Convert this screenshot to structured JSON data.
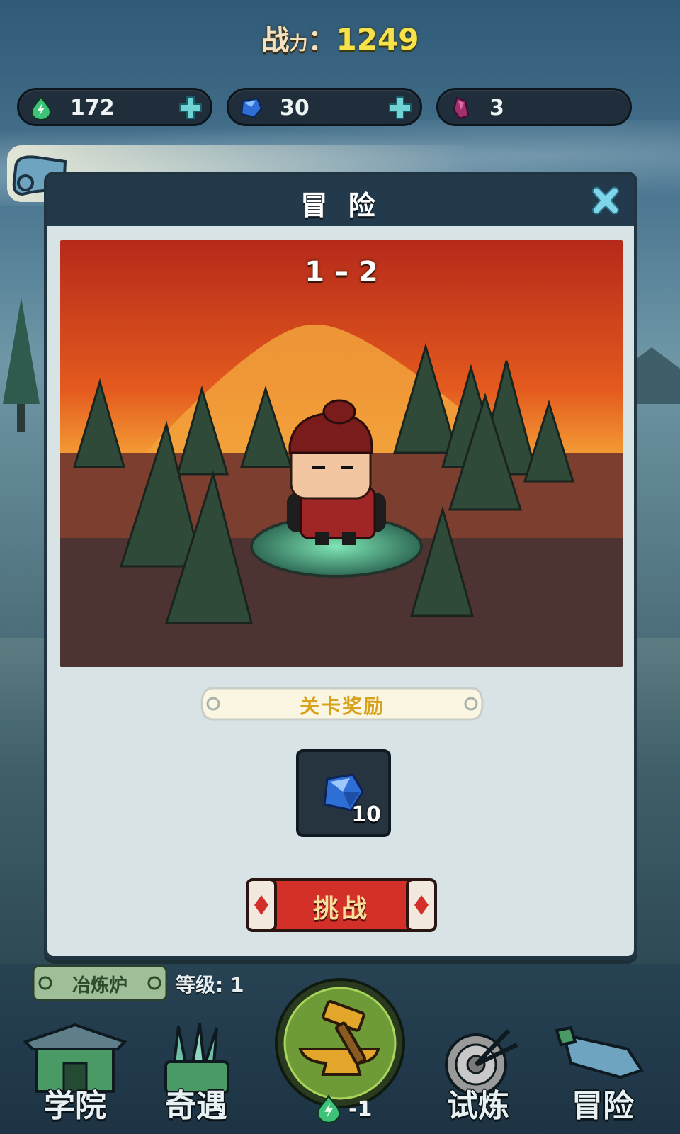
{
  "header": {
    "power_label": "战",
    "power_label_small": "力",
    "power_colon": "：",
    "power_value": "1249"
  },
  "resources": [
    {
      "name": "energy",
      "icon": "green-drop-lightning-icon",
      "value": "172",
      "has_plus": true
    },
    {
      "name": "gem",
      "icon": "blue-gem-icon",
      "value": "30",
      "has_plus": true
    },
    {
      "name": "crystal",
      "icon": "purple-crystal-icon",
      "value": "3",
      "has_plus": false
    }
  ],
  "modal": {
    "title": "冒 险",
    "stage": "1 – 2",
    "reward_title": "关卡奖励",
    "reward": {
      "icon": "blue-gem-icon",
      "count": "10"
    },
    "challenge_label": "挑战"
  },
  "bottom": {
    "furnace_label": "冶炼炉",
    "level_text": "等级: 1",
    "forge_cost": "-1",
    "nav": [
      {
        "id": "academy",
        "label": "学院",
        "icon": "academy-building-icon"
      },
      {
        "id": "encounter",
        "label": "奇遇",
        "icon": "scroll-basket-icon"
      },
      {
        "id": "trial",
        "label": "试炼",
        "icon": "target-arrows-icon"
      },
      {
        "id": "adventure",
        "label": "冒险",
        "icon": "sword-icon"
      }
    ]
  },
  "colors": {
    "power_value": "#f7e24a",
    "modal_bg": "#d7e3e4",
    "modal_header": "#223a4b",
    "challenge_red": "#d3302a",
    "reward_gold": "#d7a21c"
  }
}
